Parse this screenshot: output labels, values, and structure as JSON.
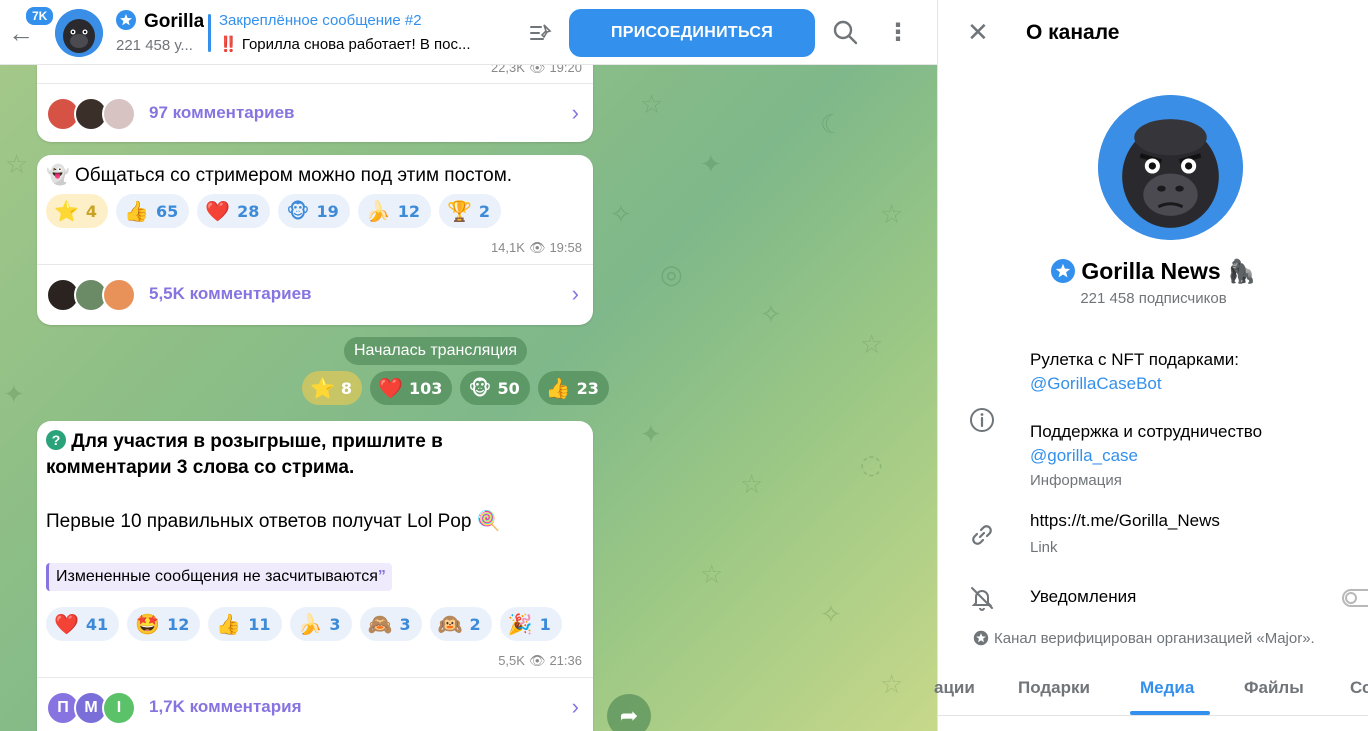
{
  "header": {
    "badge": "7K",
    "title": "Gorilla News",
    "subtitle": "221 458 у...",
    "pinned_title": "Закреплённое сообщение #2",
    "pinned_text": "‼️ Горилла снова работает! В пос...",
    "join_label": "ПРИСОЕДИНИТЬСЯ",
    "icons": [
      "back-arrow-icon",
      "pinned-list-icon",
      "search-icon",
      "more-vertical-icon"
    ]
  },
  "messages": {
    "top_partial": {
      "views": "22,3K",
      "time": "19:20"
    },
    "msg0_comments": "97 комментариев",
    "msg1": {
      "text": "Общаться со стримером можно под этим постом.",
      "reactions": [
        {
          "emoji": "⭐",
          "count": "4"
        },
        {
          "emoji": "👍",
          "count": "65"
        },
        {
          "emoji": "❤️",
          "count": "28"
        },
        {
          "emoji": "🐵",
          "count": "19"
        },
        {
          "emoji": "🍌",
          "count": "12"
        },
        {
          "emoji": "🏆",
          "count": "2"
        }
      ],
      "views": "14,1K",
      "time": "19:58",
      "comments": "5,5K комментариев"
    },
    "service": {
      "text": "Началась трансляция",
      "reactions": [
        {
          "emoji": "⭐",
          "count": "8"
        },
        {
          "emoji": "❤️",
          "count": "103"
        },
        {
          "emoji": "🐵",
          "count": "50"
        },
        {
          "emoji": "👍",
          "count": "23"
        }
      ]
    },
    "msg2": {
      "line1": "Для участия в розыгрыше, пришлите в",
      "line2": "комментарии 3 слова со стрима.",
      "line3": "Первые 10 правильных ответов получат Lol Pop",
      "quote": "Измененные сообщения не засчитываются",
      "reactions": [
        {
          "emoji": "❤️",
          "count": "41"
        },
        {
          "emoji": "🤩",
          "count": "12"
        },
        {
          "emoji": "👍",
          "count": "11"
        },
        {
          "emoji": "🍌",
          "count": "3"
        },
        {
          "emoji": "🙈",
          "count": "3"
        },
        {
          "emoji": "🙉",
          "count": "2"
        },
        {
          "emoji": "🎉",
          "count": "1"
        }
      ],
      "views": "5,5K",
      "time": "21:36",
      "comments": "1,7K комментария",
      "commenter_initials": [
        "П",
        "М",
        "I"
      ]
    }
  },
  "panel": {
    "title": "О канале",
    "name": "Gorilla News 🦍",
    "subscribers": "221 458 подписчиков",
    "desc1": "Рулетка с NFT подарками:",
    "desc1_link": "@GorillaCaseBot",
    "desc2": "Поддержка и сотрудничество",
    "desc2_link": "@gorilla_case",
    "info_label": "Информация",
    "link": "https://t.me/Gorilla_News",
    "link_label": "Link",
    "notifications": "Уведомления",
    "notifications_on": false,
    "verified_note": "Канал верифицирован организацией «Major».",
    "tabs": [
      "ации",
      "Подарки",
      "Медиа",
      "Файлы",
      "Сс"
    ],
    "active_tab": "Медиа"
  },
  "colors": {
    "accent": "#3390ec",
    "comments": "#8774e1",
    "chat_bg": "#8fbf86"
  }
}
